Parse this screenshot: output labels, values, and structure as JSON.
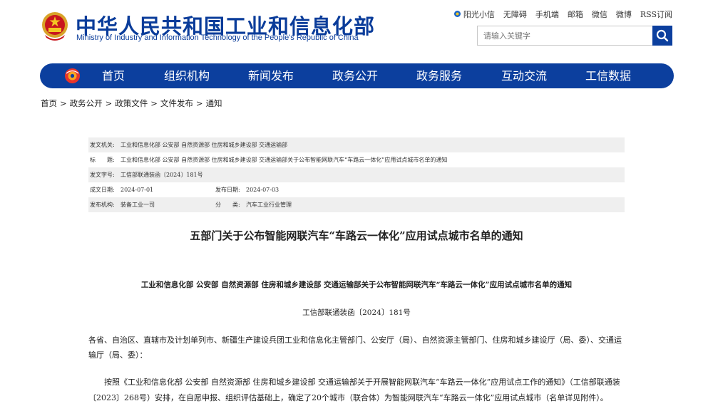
{
  "header": {
    "site_title": "中华人民共和国工业和信息化部",
    "site_subtitle": "Ministry of Industry and Information Technology of the People's Republic of China",
    "top_links": [
      "阳光小信",
      "无障碍",
      "手机端",
      "邮箱",
      "微信",
      "微博",
      "RSS订阅"
    ],
    "search_placeholder": "请输入关键字"
  },
  "nav": {
    "items": [
      "首页",
      "组织机构",
      "新闻发布",
      "政务公开",
      "政务服务",
      "互动交流",
      "工信数据"
    ]
  },
  "breadcrumb": [
    "首页",
    "政务公开",
    "政策文件",
    "文件发布",
    "通知"
  ],
  "breadcrumb_sep": ">",
  "meta": {
    "issuer_label": "发文机关:",
    "issuer_value": "工业和信息化部 公安部 自然资源部 住房和城乡建设部 交通运输部",
    "title_label": "标　　题:",
    "title_value": "工业和信息化部 公安部 自然资源部 住房和城乡建设部 交通运输部关于公布智能网联汽车“车路云一体化”应用试点城市名单的通知",
    "docno_label": "发文字号:",
    "docno_value": "工信部联通装函〔2024〕181号",
    "created_label": "成文日期:",
    "created_value": "2024-07-01",
    "published_label": "发布日期:",
    "published_value": "2024-07-03",
    "org_label": "发布机构:",
    "org_value": "装备工业一司",
    "category_label": "分　　类:",
    "category_value": "汽车工业行业管理"
  },
  "document": {
    "title": "五部门关于公布智能网联汽车“车路云一体化”应用试点城市名单的通知",
    "subtitle": "工业和信息化部 公安部 自然资源部 住房和城乡建设部 交通运输部关于公布智能网联汽车“车路云一体化”应用试点城市名单的通知",
    "doc_number": "工信部联通装函〔2024〕181号",
    "para1": "各省、自治区、直辖市及计划单列市、新疆生产建设兵团工业和信息化主管部门、公安厅（局）、自然资源主管部门、住房和城乡建设厅（局、委）、交通运输厅（局、委）：",
    "para2": "按照《工业和信息化部 公安部 自然资源部 住房和城乡建设部 交通运输部关于开展智能网联汽车“车路云一体化”应用试点工作的通知》（工信部联通装〔2023〕268号）安排，在自愿申报、组织评估基础上，确定了20个城市（联合体）为智能网联汽车“车路云一体化”应用试点城市（名单详见附件）。"
  },
  "colors": {
    "brand_blue": "#0c3f9e",
    "meta_shade": "#efefef"
  }
}
